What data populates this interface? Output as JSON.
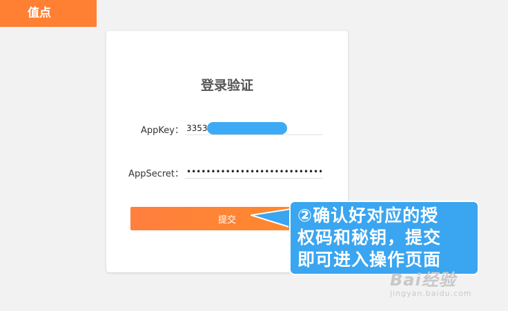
{
  "brand": {
    "label": "值点"
  },
  "login": {
    "title": "登录验证",
    "appkey_label": "AppKey：",
    "appkey_value": "3353",
    "appsecret_label": "AppSecret：",
    "appsecret_value": "••••••••••••••••••••••••••••••••",
    "submit_label": "提交"
  },
  "callout": {
    "lines": [
      "②确认好对应的授",
      "权码和秘钥，提交",
      "即可进入操作页面"
    ]
  },
  "watermark": {
    "logo": "Bai经验",
    "url": "jingyan.baidu.com"
  },
  "colors": {
    "accent": "#ff7f33",
    "callout": "#3aa5f0",
    "background": "#f2f2f2"
  }
}
